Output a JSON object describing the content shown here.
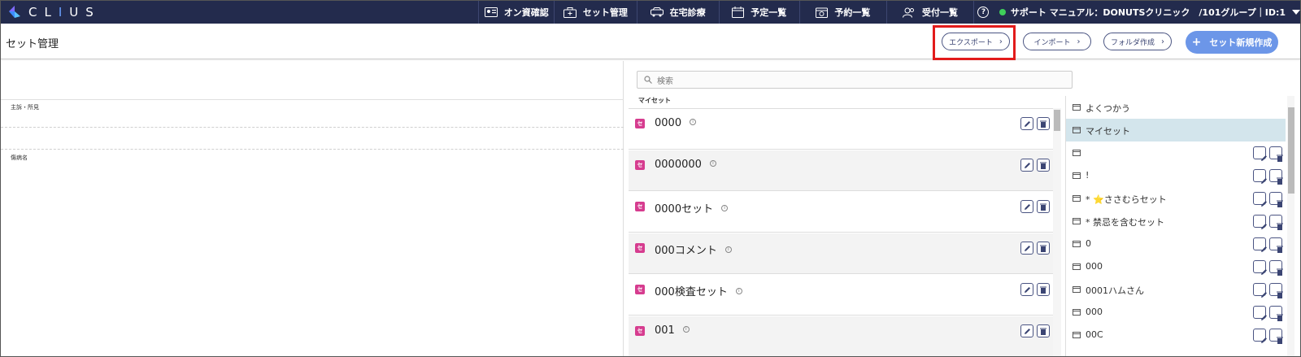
{
  "app": {
    "logo_text_pre": "CL",
    "logo_text_hl": "I",
    "logo_text_post": "US"
  },
  "nav": {
    "items": [
      {
        "label": "オン資確認",
        "icon": "id-card-icon"
      },
      {
        "label": "セット管理",
        "icon": "briefcase-icon"
      },
      {
        "label": "在宅診療",
        "icon": "car-icon"
      },
      {
        "label": "予定一覧",
        "icon": "calendar-icon"
      },
      {
        "label": "予約一覧",
        "icon": "calendar-clock-icon"
      },
      {
        "label": "受付一覧",
        "icon": "users-icon"
      }
    ],
    "help": "?",
    "status_text": "サポート マニュアル：DONUTSクリニック　/101グループ｜ID:1",
    "status_color": "#3fcf5a"
  },
  "header": {
    "title": "セット管理",
    "export_label": "エクスポート",
    "import_label": "インポート",
    "folder_label": "フォルダ作成",
    "new_set_label": "セット新規作成",
    "primary_color": "#6c96e8",
    "highlight_color": "#e21b1b"
  },
  "editor": {
    "diagnosis_label": "主訴・所見",
    "disease_label": "傷病名"
  },
  "sets": {
    "search_placeholder": "検索",
    "section_label": "マイセット",
    "badge": "セ",
    "badge_color": "#d63c8f",
    "rows": [
      {
        "name": "0000"
      },
      {
        "name": "0000000"
      },
      {
        "name": "0000セット"
      },
      {
        "name": "000コメント"
      },
      {
        "name": "000検査セット"
      },
      {
        "name": "001"
      }
    ]
  },
  "folders": {
    "items": [
      {
        "name": "よくつかう",
        "selected": false,
        "star": ""
      },
      {
        "name": "マイセット",
        "selected": true,
        "star": ""
      },
      {
        "name": "",
        "selected": false,
        "star": ""
      },
      {
        "name": "!",
        "selected": false,
        "star": ""
      },
      {
        "name": "ささむらセット",
        "selected": false,
        "star": "⭐",
        "prefix": "* "
      },
      {
        "name": "* 禁忌を含むセット",
        "selected": false,
        "star": ""
      },
      {
        "name": "0",
        "selected": false,
        "star": ""
      },
      {
        "name": "000",
        "selected": false,
        "star": ""
      },
      {
        "name": "0001ハムさん",
        "selected": false,
        "star": ""
      },
      {
        "name": "000",
        "selected": false,
        "star": ""
      },
      {
        "name": "00C",
        "selected": false,
        "star": ""
      }
    ]
  }
}
